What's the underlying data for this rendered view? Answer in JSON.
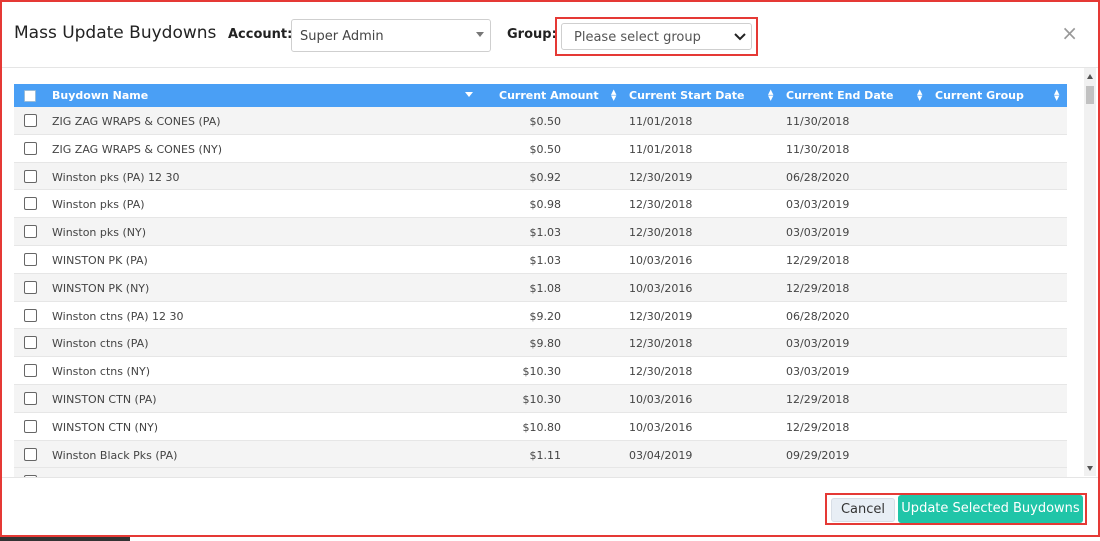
{
  "modal": {
    "title": "Mass Update Buydowns",
    "account_label": "Account:",
    "account_value": "Super Admin",
    "group_label": "Group:",
    "group_placeholder": "Please select group",
    "close_glyph": "×"
  },
  "table": {
    "columns": [
      "Buydown Name",
      "Current Amount",
      "Current Start Date",
      "Current End Date",
      "Current Group"
    ],
    "rows": [
      {
        "name": "ZIG ZAG WRAPS & CONES (PA)",
        "amount": "$0.50",
        "start": "11/01/2018",
        "end": "11/30/2018",
        "group": ""
      },
      {
        "name": "ZIG ZAG WRAPS & CONES (NY)",
        "amount": "$0.50",
        "start": "11/01/2018",
        "end": "11/30/2018",
        "group": ""
      },
      {
        "name": "Winston pks (PA) 12 30",
        "amount": "$0.92",
        "start": "12/30/2019",
        "end": "06/28/2020",
        "group": ""
      },
      {
        "name": "Winston pks (PA)",
        "amount": "$0.98",
        "start": "12/30/2018",
        "end": "03/03/2019",
        "group": ""
      },
      {
        "name": "Winston pks (NY)",
        "amount": "$1.03",
        "start": "12/30/2018",
        "end": "03/03/2019",
        "group": ""
      },
      {
        "name": "WINSTON PK (PA)",
        "amount": "$1.03",
        "start": "10/03/2016",
        "end": "12/29/2018",
        "group": ""
      },
      {
        "name": "WINSTON PK (NY)",
        "amount": "$1.08",
        "start": "10/03/2016",
        "end": "12/29/2018",
        "group": ""
      },
      {
        "name": "Winston ctns (PA) 12 30",
        "amount": "$9.20",
        "start": "12/30/2019",
        "end": "06/28/2020",
        "group": ""
      },
      {
        "name": "Winston ctns (PA)",
        "amount": "$9.80",
        "start": "12/30/2018",
        "end": "03/03/2019",
        "group": ""
      },
      {
        "name": "Winston ctns (NY)",
        "amount": "$10.30",
        "start": "12/30/2018",
        "end": "03/03/2019",
        "group": ""
      },
      {
        "name": "WINSTON CTN (PA)",
        "amount": "$10.30",
        "start": "10/03/2016",
        "end": "12/29/2018",
        "group": ""
      },
      {
        "name": "WINSTON CTN (NY)",
        "amount": "$10.80",
        "start": "10/03/2016",
        "end": "12/29/2018",
        "group": ""
      },
      {
        "name": "Winston Black Pks (PA)",
        "amount": "$1.11",
        "start": "03/04/2019",
        "end": "09/29/2019",
        "group": ""
      }
    ]
  },
  "footer": {
    "cancel_label": "Cancel",
    "update_label": "Update Selected Buydowns"
  },
  "colors": {
    "header_blue": "#4a9ff5",
    "highlight_red": "#e53935",
    "update_teal": "#20c5a8"
  }
}
